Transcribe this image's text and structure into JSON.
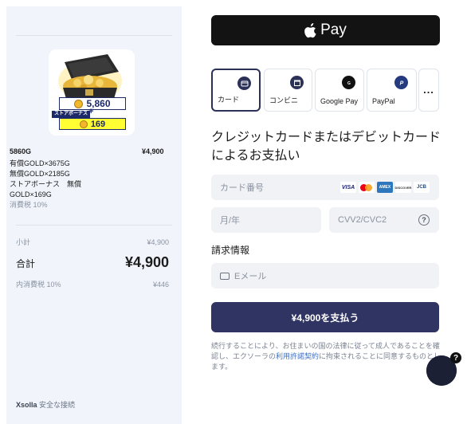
{
  "summary": {
    "bundle_name": "5860G",
    "bundle_price": "¥4,900",
    "image": {
      "amount": "5,860",
      "bonus_label": "ストアボーナス",
      "plus": "+",
      "bonus_amount": "169"
    },
    "items": [
      "有償GOLD×3675G",
      "無償GOLD×2185G",
      "ストアボーナス　無償GOLD×169G"
    ],
    "tax_note": "消費税 10%",
    "subtotal_label": "小計",
    "subtotal_value": "¥4,900",
    "total_label": "合計",
    "total_value": "¥4,900",
    "tax_label": "内消費税 10%",
    "tax_value": "¥446",
    "secure_brand": "Xsolla",
    "secure_text": "安全な接続"
  },
  "apple_pay": {
    "label": "Pay"
  },
  "methods": [
    {
      "label": "カード",
      "icon": "card-icon",
      "selected": true
    },
    {
      "label": "コンビニ",
      "icon": "store-icon",
      "selected": false
    },
    {
      "label": "Google Pay",
      "icon": "google-pay-icon",
      "selected": false
    },
    {
      "label": "PayPal",
      "icon": "paypal-icon",
      "selected": false
    },
    {
      "label": "...",
      "icon": "more-icon",
      "selected": false
    }
  ],
  "form": {
    "heading": "クレジットカードまたはデビットカードによるお支払い",
    "card_number_placeholder": "カード番号",
    "card_brands": [
      "VISA",
      "MC",
      "AMEX",
      "DISCOVER",
      "JCB"
    ],
    "expiry_placeholder": "月/年",
    "cvv_placeholder": "CVV2/CVC2",
    "cvv_help": "?",
    "billing_title": "請求情報",
    "email_placeholder": "Eメール",
    "pay_button": "¥4,900を支払う"
  },
  "legal": {
    "before": "続行することにより、お住まいの国の法律に従って成人であることを確認し、エクソーラの",
    "link": "利用許諾契約",
    "after": "に拘束されることに同意するものとします。"
  },
  "chatbot": {
    "badge": "?"
  },
  "colors": {
    "primary": "#303462",
    "left_panel": "#f1f5fb",
    "field_bg": "#f1f2f5",
    "link": "#3d6fc4"
  }
}
